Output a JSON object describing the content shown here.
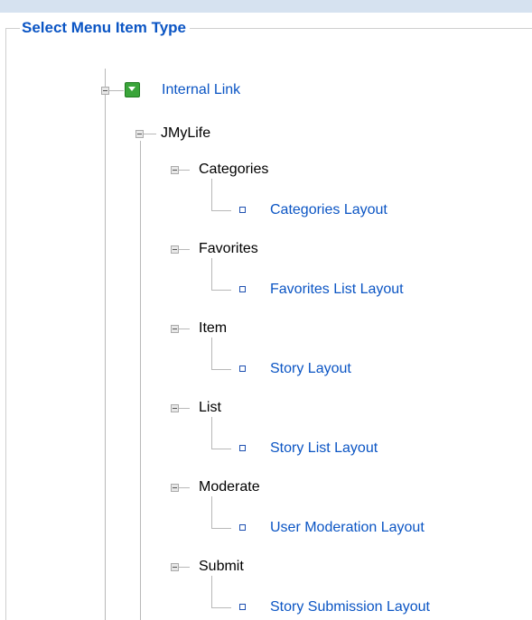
{
  "panel": {
    "legend": "Select Menu Item Type"
  },
  "tree": {
    "root": {
      "label": "Internal Link",
      "icon": "expand-icon"
    },
    "component": {
      "label": "JMyLife"
    },
    "groups": [
      {
        "label": "Categories",
        "leaf": "Categories Layout"
      },
      {
        "label": "Favorites",
        "leaf": "Favorites List Layout"
      },
      {
        "label": "Item",
        "leaf": "Story Layout"
      },
      {
        "label": "List",
        "leaf": "Story List Layout"
      },
      {
        "label": "Moderate",
        "leaf": "User Moderation Layout"
      },
      {
        "label": "Submit",
        "leaf": "Story Submission Layout"
      }
    ]
  }
}
